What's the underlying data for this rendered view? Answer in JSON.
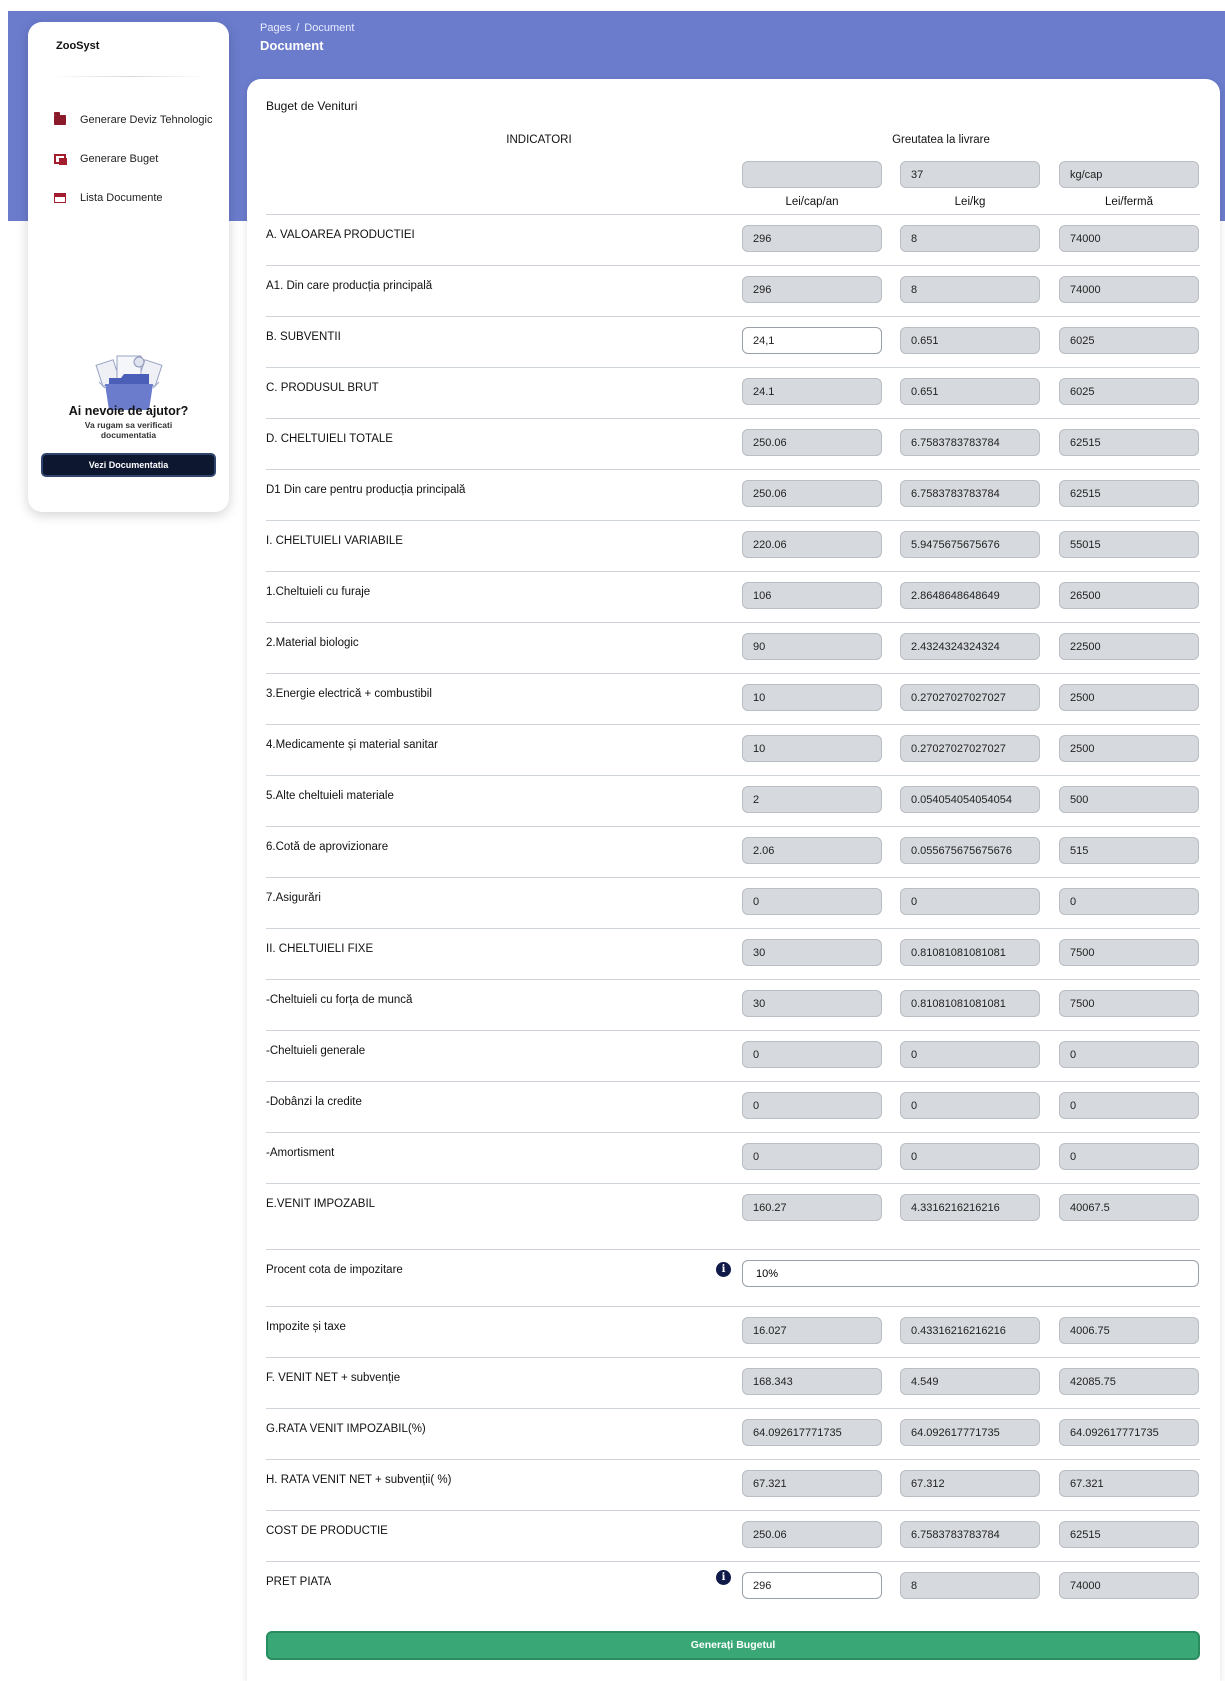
{
  "header": {
    "breadcrumb_root": "Pages",
    "breadcrumb_sep": "/",
    "breadcrumb_current": "Document",
    "title": "Document"
  },
  "sidebar": {
    "brand": "ZooSyst",
    "items": [
      {
        "label": "Generare Deviz Tehnologic",
        "icon": "folder-icon"
      },
      {
        "label": "Generare Buget",
        "icon": "copy-icon"
      },
      {
        "label": "Lista Documente",
        "icon": "calendar-icon"
      }
    ],
    "help": {
      "title": "Ai nevoie de ajutor?",
      "subtitle": "Va rugam sa verificati documentatia",
      "button": "Vezi Documentatia"
    }
  },
  "main": {
    "card_title": "Buget de Venituri",
    "indicatori_label": "INDICATORI",
    "weight_label": "Greutatea la livrare",
    "weight_inputs": [
      "",
      "37",
      "kg/cap"
    ],
    "columns": [
      "Lei/cap/an",
      "Lei/kg",
      "Lei/fermă"
    ],
    "rows": [
      {
        "label": "A. VALOAREA PRODUCTIEI",
        "values": [
          "296",
          "8",
          "74000"
        ]
      },
      {
        "label": "A1. Din care producția principală",
        "values": [
          "296",
          "8",
          "74000"
        ]
      },
      {
        "label": "B. SUBVENTII",
        "values": [
          "24,1",
          "0.651",
          "6025"
        ]
      },
      {
        "label": "C. PRODUSUL BRUT",
        "values": [
          "24.1",
          "0.651",
          "6025"
        ]
      },
      {
        "label": "D. CHELTUIELI TOTALE",
        "values": [
          "250.06",
          "6.7583783783784",
          "62515"
        ]
      },
      {
        "label": "D1 Din care pentru producția principală",
        "values": [
          "250.06",
          "6.7583783783784",
          "62515"
        ]
      },
      {
        "label": "I. CHELTUIELI VARIABILE",
        "values": [
          "220.06",
          "5.9475675675676",
          "55015"
        ]
      },
      {
        "label": "1.Cheltuieli cu furaje",
        "values": [
          "106",
          "2.8648648648649",
          "26500"
        ]
      },
      {
        "label": "2.Material biologic",
        "values": [
          "90",
          "2.4324324324324",
          "22500"
        ]
      },
      {
        "label": "3.Energie electrică + combustibil",
        "values": [
          "10",
          "0.27027027027027",
          "2500"
        ]
      },
      {
        "label": "4.Medicamente și material sanitar",
        "values": [
          "10",
          "0.27027027027027",
          "2500"
        ]
      },
      {
        "label": "5.Alte cheltuieli materiale",
        "values": [
          "2",
          "0.054054054054054",
          "500"
        ]
      },
      {
        "label": "6.Cotă de aprovizionare",
        "values": [
          "2.06",
          "0.055675675675676",
          "515"
        ]
      },
      {
        "label": "7.Asigurări",
        "values": [
          "0",
          "0",
          "0"
        ]
      },
      {
        "label": "II. CHELTUIELI FIXE",
        "values": [
          "30",
          "0.81081081081081",
          "7500"
        ]
      },
      {
        "label": "-Cheltuieli cu forța de muncă",
        "values": [
          "30",
          "0.81081081081081",
          "7500"
        ]
      },
      {
        "label": "-Cheltuieli generale",
        "values": [
          "0",
          "0",
          "0"
        ]
      },
      {
        "label": "-Dobânzi la credite",
        "values": [
          "0",
          "0",
          "0"
        ]
      },
      {
        "label": "-Amortisment",
        "values": [
          "0",
          "0",
          "0"
        ]
      },
      {
        "label": "E.VENIT IMPOZABIL",
        "values": [
          "160.27",
          "4.3316216216216",
          "40067.5"
        ]
      }
    ],
    "tax_percent": {
      "label": "Procent cota de impozitare",
      "value": "10%"
    },
    "rows2": [
      {
        "label": "Impozite și taxe",
        "values": [
          "16.027",
          "0.43316216216216",
          "4006.75"
        ]
      },
      {
        "label": "F. VENIT NET + subvenție",
        "values": [
          "168.343",
          "4.549",
          "42085.75"
        ]
      },
      {
        "label": "G.RATA VENIT IMPOZABIL(%)",
        "values": [
          "64.092617771735",
          "64.092617771735",
          "64.092617771735"
        ]
      },
      {
        "label": "H. RATA VENIT NET + subvenții( %)",
        "values": [
          "67.321",
          "67.312",
          "67.321"
        ]
      },
      {
        "label": "COST DE PRODUCTIE",
        "values": [
          "250.06",
          "6.7583783783784",
          "62515"
        ]
      },
      {
        "label": "PRET PIATA",
        "values": [
          "296",
          "8",
          "74000"
        ]
      }
    ],
    "info_glyph": "i",
    "generate_button": "Generați Bugetul"
  }
}
